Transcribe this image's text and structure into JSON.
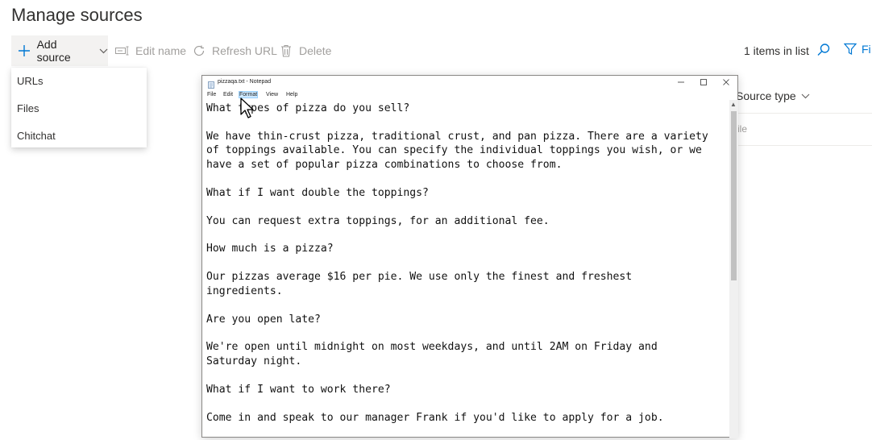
{
  "page": {
    "title": "Manage sources"
  },
  "toolbar": {
    "add_source": "Add source",
    "edit_name": "Edit name",
    "refresh_url": "Refresh URL",
    "delete": "Delete",
    "items_count": "1 items in list",
    "filter": "Fi"
  },
  "add_menu": {
    "items": [
      "URLs",
      "Files",
      "Chitchat"
    ]
  },
  "table": {
    "column_source_type": "Source type",
    "row_source_type": "ile"
  },
  "notepad": {
    "title": "pizzaqa.txt - Notepad",
    "menus": [
      "File",
      "Edit",
      "Format",
      "View",
      "Help"
    ],
    "active_menu": "Format",
    "lines": [
      "What types of pizza do you sell?",
      "",
      "We have thin-crust pizza, traditional crust, and pan pizza. There are a variety",
      "of toppings available. You can specify the individual toppings you wish, or we",
      "have a set of popular pizza combinations to choose from.",
      "",
      "What if I want double the toppings?",
      "",
      "You can request extra toppings, for an additional fee.",
      "",
      "How much is a pizza?",
      "",
      "Our pizzas average $16 per pie. We use only the finest and freshest",
      "ingredients.",
      "",
      "Are you open late?",
      "",
      "We're open until midnight on most weekdays, and until 2AM on Friday and",
      "Saturday night.",
      "",
      "What if I want to work there?",
      "",
      "Come in and speak to our manager Frank if you'd like to apply for a job."
    ]
  },
  "colors": {
    "accent": "#0078d4",
    "disabled": "#a19f9d",
    "toolbar_hover": "#f3f2f1"
  },
  "icons": {
    "add": "plus-icon",
    "chevron": "chevron-down-icon",
    "edit": "edit-name-icon",
    "refresh": "refresh-icon",
    "delete": "trash-icon",
    "search": "search-icon",
    "filter": "filter-icon"
  }
}
